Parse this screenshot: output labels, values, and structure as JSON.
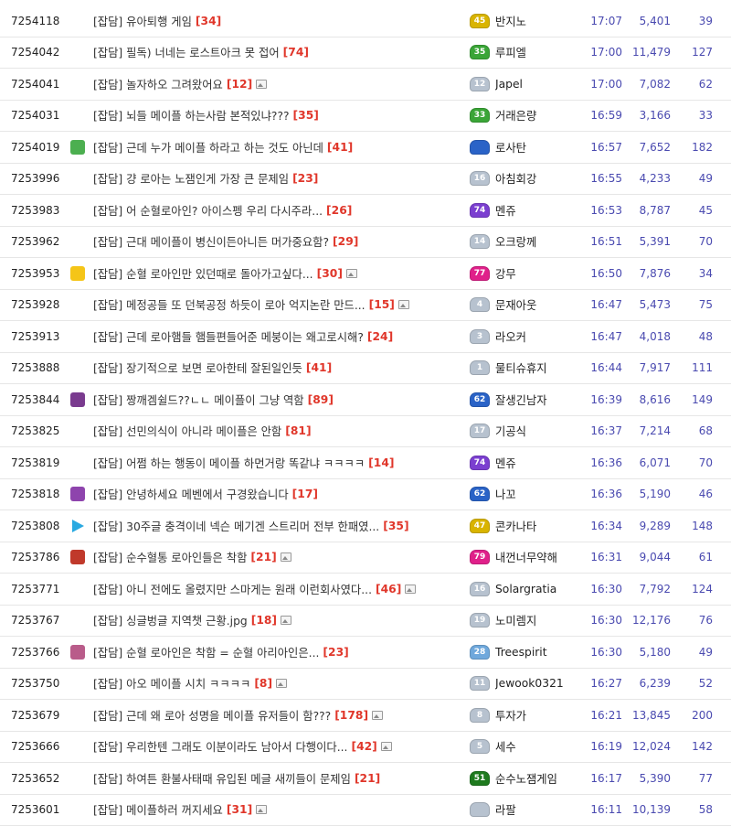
{
  "colors": {
    "comment": "#e0362a",
    "meta": "#4a4ab0",
    "level_gold": "#d9b400",
    "level_green": "#3aa537",
    "level_gray": "#b7c2cf",
    "level_blue": "#2a63c7",
    "level_purple": "#7b3fd0",
    "level_pink": "#e0208a",
    "level_darkgreen": "#1e7a1e"
  },
  "rows": [
    {
      "no": "7254118",
      "tag_icon": "",
      "title": "[잡담] 유아퇴행 게임",
      "comments": "[34]",
      "has_image": false,
      "level": "45",
      "level_color": "#d9b400",
      "nick": "반지노",
      "time": "17:07",
      "views": "5,401",
      "likes": "39"
    },
    {
      "no": "7254042",
      "tag_icon": "",
      "title": "[잡담] 필독) 너네는 로스트아크 못 접어",
      "comments": "[74]",
      "has_image": false,
      "level": "35",
      "level_color": "#3aa537",
      "nick": "루피엘",
      "time": "17:00",
      "views": "11,479",
      "likes": "127"
    },
    {
      "no": "7254041",
      "tag_icon": "",
      "title": "[잡담] 놀자하오 그려왔어요",
      "comments": "[12]",
      "has_image": true,
      "level": "12",
      "level_color": "#b7c2cf",
      "nick": "Japel",
      "time": "17:00",
      "views": "7,082",
      "likes": "62"
    },
    {
      "no": "7254031",
      "tag_icon": "",
      "title": "[잡담] 뇌들 메이플 하는사람 본적있냐???",
      "comments": "[35]",
      "has_image": false,
      "level": "33",
      "level_color": "#3aa537",
      "nick": "거래은량",
      "time": "16:59",
      "views": "3,166",
      "likes": "33"
    },
    {
      "no": "7254019",
      "tag_icon": "frog-icon",
      "title": "[잡담] 근데 누가 메이플 하라고 하는 것도 아닌데",
      "comments": "[41]",
      "has_image": false,
      "level": "",
      "level_color": "#2a63c7",
      "nick": "로사탄",
      "time": "16:57",
      "views": "7,652",
      "likes": "182"
    },
    {
      "no": "7253996",
      "tag_icon": "",
      "title": "[잡담] 걍 로아는 노잼인게 가장 큰 문제임",
      "comments": "[23]",
      "has_image": false,
      "level": "16",
      "level_color": "#b7c2cf",
      "nick": "아침회강",
      "time": "16:55",
      "views": "4,233",
      "likes": "49"
    },
    {
      "no": "7253983",
      "tag_icon": "",
      "title": "[잡담] 어 순혈로아인? 아이스펭 우리 다시주라...",
      "comments": "[26]",
      "has_image": false,
      "level": "74",
      "level_color": "#7b3fd0",
      "nick": "멘쥬",
      "time": "16:53",
      "views": "8,787",
      "likes": "45"
    },
    {
      "no": "7253962",
      "tag_icon": "",
      "title": "[잡담] 근대 메이플이 병신이든아니든 머가중요함?",
      "comments": "[29]",
      "has_image": false,
      "level": "14",
      "level_color": "#b7c2cf",
      "nick": "오크랑께",
      "time": "16:51",
      "views": "5,391",
      "likes": "70"
    },
    {
      "no": "7253953",
      "tag_icon": "star-badge-icon",
      "title": "[잡담] 순혈 로아인만 있던때로 돌아가고싶다...",
      "comments": "[30]",
      "has_image": true,
      "level": "77",
      "level_color": "#e0208a",
      "nick": "강무",
      "time": "16:50",
      "views": "7,876",
      "likes": "34"
    },
    {
      "no": "7253928",
      "tag_icon": "",
      "title": "[잡담] 메정공들 또 던북공정 하듯이 로아 억지논란 만드...",
      "comments": "[15]",
      "has_image": true,
      "level": "4",
      "level_color": "#b7c2cf",
      "nick": "문재아웃",
      "time": "16:47",
      "views": "5,473",
      "likes": "75"
    },
    {
      "no": "7253913",
      "tag_icon": "",
      "title": "[잡담] 근데 로아햄들 햄들편들어준 메붕이는 왜고로시해?",
      "comments": "[24]",
      "has_image": false,
      "level": "3",
      "level_color": "#b7c2cf",
      "nick": "라오커",
      "time": "16:47",
      "views": "4,018",
      "likes": "48"
    },
    {
      "no": "7253888",
      "tag_icon": "",
      "title": "[잡담] 장기적으로 보면 로아한테 잘된일인듯",
      "comments": "[41]",
      "has_image": false,
      "level": "1",
      "level_color": "#b7c2cf",
      "nick": "물티슈휴지",
      "time": "16:44",
      "views": "7,917",
      "likes": "111"
    },
    {
      "no": "7253844",
      "tag_icon": "mask-icon",
      "title": "[잡담] 짱깨겜쉴드??ㄴㄴ 메이플이 그냥 역함",
      "comments": "[89]",
      "has_image": false,
      "level": "62",
      "level_color": "#2a63c7",
      "nick": "잘생긴남자",
      "time": "16:39",
      "views": "8,616",
      "likes": "149"
    },
    {
      "no": "7253825",
      "tag_icon": "",
      "title": "[잡담] 선민의식이 아니라 메이플은 안함",
      "comments": "[81]",
      "has_image": false,
      "level": "17",
      "level_color": "#b7c2cf",
      "nick": "기공식",
      "time": "16:37",
      "views": "7,214",
      "likes": "68"
    },
    {
      "no": "7253819",
      "tag_icon": "",
      "title": "[잡담] 어쩜 하는 행동이 메이플 하먼거랑 똑같냐 ㅋㅋㅋㅋ",
      "comments": "[14]",
      "has_image": false,
      "level": "74",
      "level_color": "#7b3fd0",
      "nick": "멘쥬",
      "time": "16:36",
      "views": "6,071",
      "likes": "70"
    },
    {
      "no": "7253818",
      "tag_icon": "sun-badge-icon",
      "title": "[잡담] 안녕하세요 메벤에서 구경왔습니다",
      "comments": "[17]",
      "has_image": false,
      "level": "62",
      "level_color": "#2a63c7",
      "nick": "나꼬",
      "time": "16:36",
      "views": "5,190",
      "likes": "46"
    },
    {
      "no": "7253808",
      "tag_icon": "play-icon",
      "title": "[잡담] 30주글 충격이네 넥슨 메기겐 스트리머 전부 한패였...",
      "comments": "[35]",
      "has_image": false,
      "level": "47",
      "level_color": "#d9b400",
      "nick": "콘카나타",
      "time": "16:34",
      "views": "9,289",
      "likes": "148"
    },
    {
      "no": "7253786",
      "tag_icon": "face-icon",
      "title": "[잡담] 순수혈통 로아인들은 착함",
      "comments": "[21]",
      "has_image": true,
      "level": "79",
      "level_color": "#e0208a",
      "nick": "내껀너무약해",
      "time": "16:31",
      "views": "9,044",
      "likes": "61"
    },
    {
      "no": "7253771",
      "tag_icon": "",
      "title": "[잡담] 아니 전에도 올렸지만 스마게는 원래 이런회사였다...",
      "comments": "[46]",
      "has_image": true,
      "level": "16",
      "level_color": "#b7c2cf",
      "nick": "Solargratia",
      "time": "16:30",
      "views": "7,792",
      "likes": "124"
    },
    {
      "no": "7253767",
      "tag_icon": "",
      "title": "[잡담] 싱글벙글 지역챗 근황.jpg",
      "comments": "[18]",
      "has_image": true,
      "level": "19",
      "level_color": "#b7c2cf",
      "nick": "노미렘지",
      "time": "16:30",
      "views": "12,176",
      "likes": "76"
    },
    {
      "no": "7253766",
      "tag_icon": "portrait-icon",
      "title": "[잡담] 순혈 로아인은 착함 = 순혈 아리아인은...",
      "comments": "[23]",
      "has_image": false,
      "level": "28",
      "level_color": "#6fa8dc",
      "nick": "Treespirit",
      "time": "16:30",
      "views": "5,180",
      "likes": "49"
    },
    {
      "no": "7253750",
      "tag_icon": "",
      "title": "[잡담] 아오 메이플 시치 ㅋㅋㅋㅋ",
      "comments": "[8]",
      "has_image": true,
      "level": "11",
      "level_color": "#b7c2cf",
      "nick": "Jewook0321",
      "time": "16:27",
      "views": "6,239",
      "likes": "52"
    },
    {
      "no": "7253679",
      "tag_icon": "",
      "title": "[잡담] 근데 왜 로아 성명을 메이플 유저들이 함???",
      "comments": "[178]",
      "has_image": true,
      "level": "8",
      "level_color": "#b7c2cf",
      "nick": "투자가",
      "time": "16:21",
      "views": "13,845",
      "likes": "200"
    },
    {
      "no": "7253666",
      "tag_icon": "",
      "title": "[잡담] 우리한텐 그래도 이분이라도 남아서 다행이다...",
      "comments": "[42]",
      "has_image": true,
      "level": "5",
      "level_color": "#b7c2cf",
      "nick": "세수",
      "time": "16:19",
      "views": "12,024",
      "likes": "142"
    },
    {
      "no": "7253652",
      "tag_icon": "",
      "title": "[잡담] 하여튼 환불사태때 유입된 메글 새끼들이 문제임",
      "comments": "[21]",
      "has_image": false,
      "level": "51",
      "level_color": "#1e7a1e",
      "nick": "순수노잼게임",
      "time": "16:17",
      "views": "5,390",
      "likes": "77"
    },
    {
      "no": "7253601",
      "tag_icon": "",
      "title": "[잡담] 메이플하러 꺼지세요",
      "comments": "[31]",
      "has_image": true,
      "level": "",
      "level_color": "#b7c2cf",
      "nick": "라팔",
      "time": "16:11",
      "views": "10,139",
      "likes": "58"
    }
  ]
}
